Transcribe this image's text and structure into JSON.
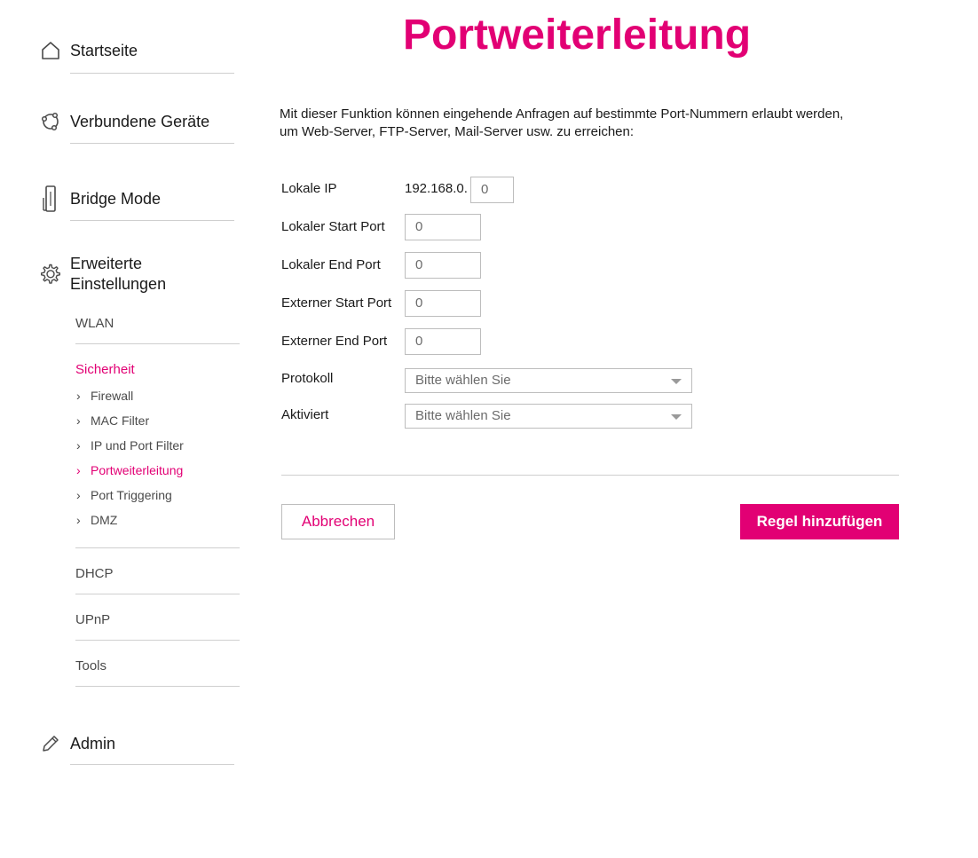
{
  "page": {
    "title": "Portweiterleitung"
  },
  "sidebar": {
    "startseite": {
      "label": "Startseite",
      "icon": "home-icon"
    },
    "geraete": {
      "label": "Verbundene Geräte",
      "icon": "devices-icon"
    },
    "bridge": {
      "label": "Bridge Mode",
      "icon": "router-icon"
    },
    "erweitert": {
      "label_line1": "Erweiterte",
      "label_line2": "Einstellungen",
      "icon": "gear-icon"
    },
    "sub": {
      "wlan": "WLAN",
      "sicherheit": "Sicherheit",
      "leaves": [
        "Firewall",
        "MAC Filter",
        "IP und Port Filter",
        "Portweiterleitung",
        "Port Triggering",
        "DMZ"
      ],
      "dhcp": "DHCP",
      "upnp": "UPnP",
      "tools": "Tools"
    },
    "admin": {
      "label": "Admin",
      "icon": "pencil-icon"
    }
  },
  "main": {
    "description": "Mit dieser Funktion können eingehende Anfragen auf bestimmte Port-Nummern erlaubt werden, um Web-Server, FTP-Server, Mail-Server usw. zu erreichen:",
    "form": {
      "lokale_ip": {
        "label": "Lokale IP",
        "prefix": "192.168.0.",
        "value": "0"
      },
      "lokaler_start_port": {
        "label": "Lokaler Start Port",
        "value": "0"
      },
      "lokaler_end_port": {
        "label": "Lokaler End Port",
        "value": "0"
      },
      "externer_start_port": {
        "label": "Externer Start Port",
        "value": "0"
      },
      "externer_end_port": {
        "label": "Externer End Port",
        "value": "0"
      },
      "protokoll": {
        "label": "Protokoll",
        "selected": "Bitte wählen Sie"
      },
      "aktiviert": {
        "label": "Aktiviert",
        "selected": "Bitte wählen Sie"
      }
    },
    "buttons": {
      "cancel": "Abbrechen",
      "add": "Regel hinzufügen"
    }
  },
  "colors": {
    "brand": "#e20074",
    "text": "#1a1a1a",
    "muted": "#4a4a4a",
    "border": "#bdbdbd"
  }
}
